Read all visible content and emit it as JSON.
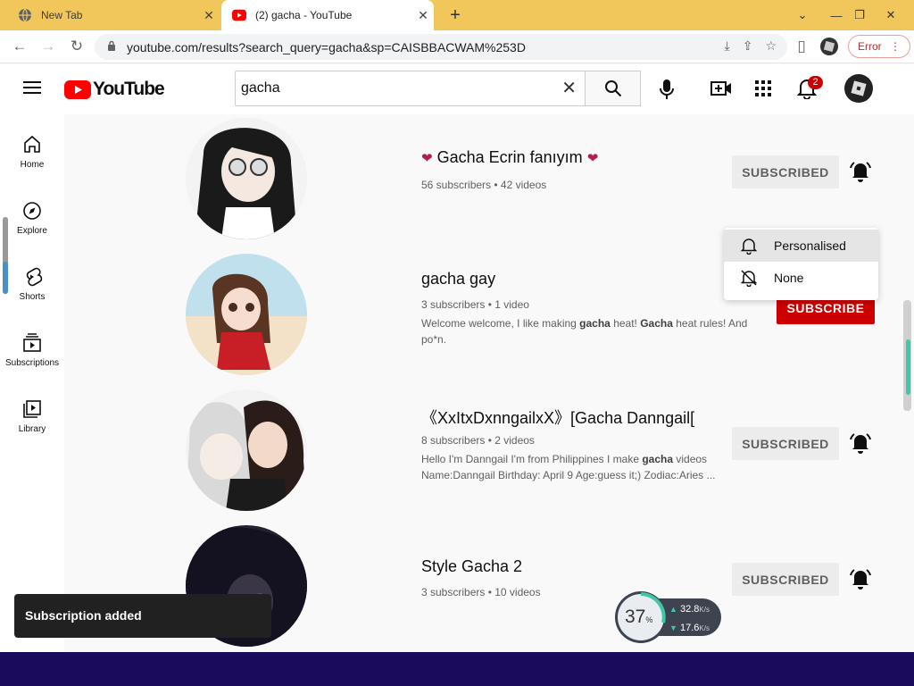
{
  "browser": {
    "tabs": [
      {
        "title": "New Tab",
        "icon": "globe-icon"
      },
      {
        "title": "(2) gacha - YouTube",
        "icon": "youtube-icon"
      }
    ],
    "url": "youtube.com/results?search_query=gacha&sp=CAISBBACWAM%253D",
    "error_label": "Error"
  },
  "youtube": {
    "logo_text": "YouTube",
    "search_value": "gacha",
    "notification_count": "2",
    "sidebar": [
      {
        "label": "Home",
        "icon": "home-icon"
      },
      {
        "label": "Explore",
        "icon": "explore-icon"
      },
      {
        "label": "Shorts",
        "icon": "shorts-icon"
      },
      {
        "label": "Subscriptions",
        "icon": "subscriptions-icon"
      },
      {
        "label": "Library",
        "icon": "library-icon"
      }
    ],
    "results": [
      {
        "name": "Gacha Ecrin fanıyım",
        "meta": "56 subscribers • 42 videos",
        "description": "",
        "button": "SUBSCRIBED"
      },
      {
        "name": "gacha gay",
        "meta": "3 subscribers • 1 video",
        "description_parts": [
          "Welcome welcome, I like making ",
          "gacha",
          " heat! ",
          "Gacha",
          " heat rules! And po*n."
        ],
        "button": "SUBSCRIBE"
      },
      {
        "name": "《XxItxDxnngailxX》[Gacha Danngail[",
        "meta": "8 subscribers • 2 videos",
        "description_parts": [
          "Hello I'm Danngail I'm from Philippines I make ",
          "gacha",
          " videos Name:Danngail Birthday: April 9 Age:guess it;) Zodiac:Aries ..."
        ],
        "button": "SUBSCRIBED"
      },
      {
        "name": "Style Gacha 2",
        "meta": "3 subscribers • 10 videos",
        "description": "",
        "button": "SUBSCRIBED"
      }
    ],
    "notif_menu": [
      "Personalised",
      "None"
    ],
    "toast": "Subscription added"
  },
  "network_widget": {
    "percent": "37",
    "percent_unit": "%",
    "up": "32.8",
    "down": "17.6",
    "unit": "K/s"
  },
  "colors": {
    "tab_strip": "#f1c75b",
    "subscribe_red": "#cc0000",
    "bottom_bar": "#1b0b5c"
  }
}
